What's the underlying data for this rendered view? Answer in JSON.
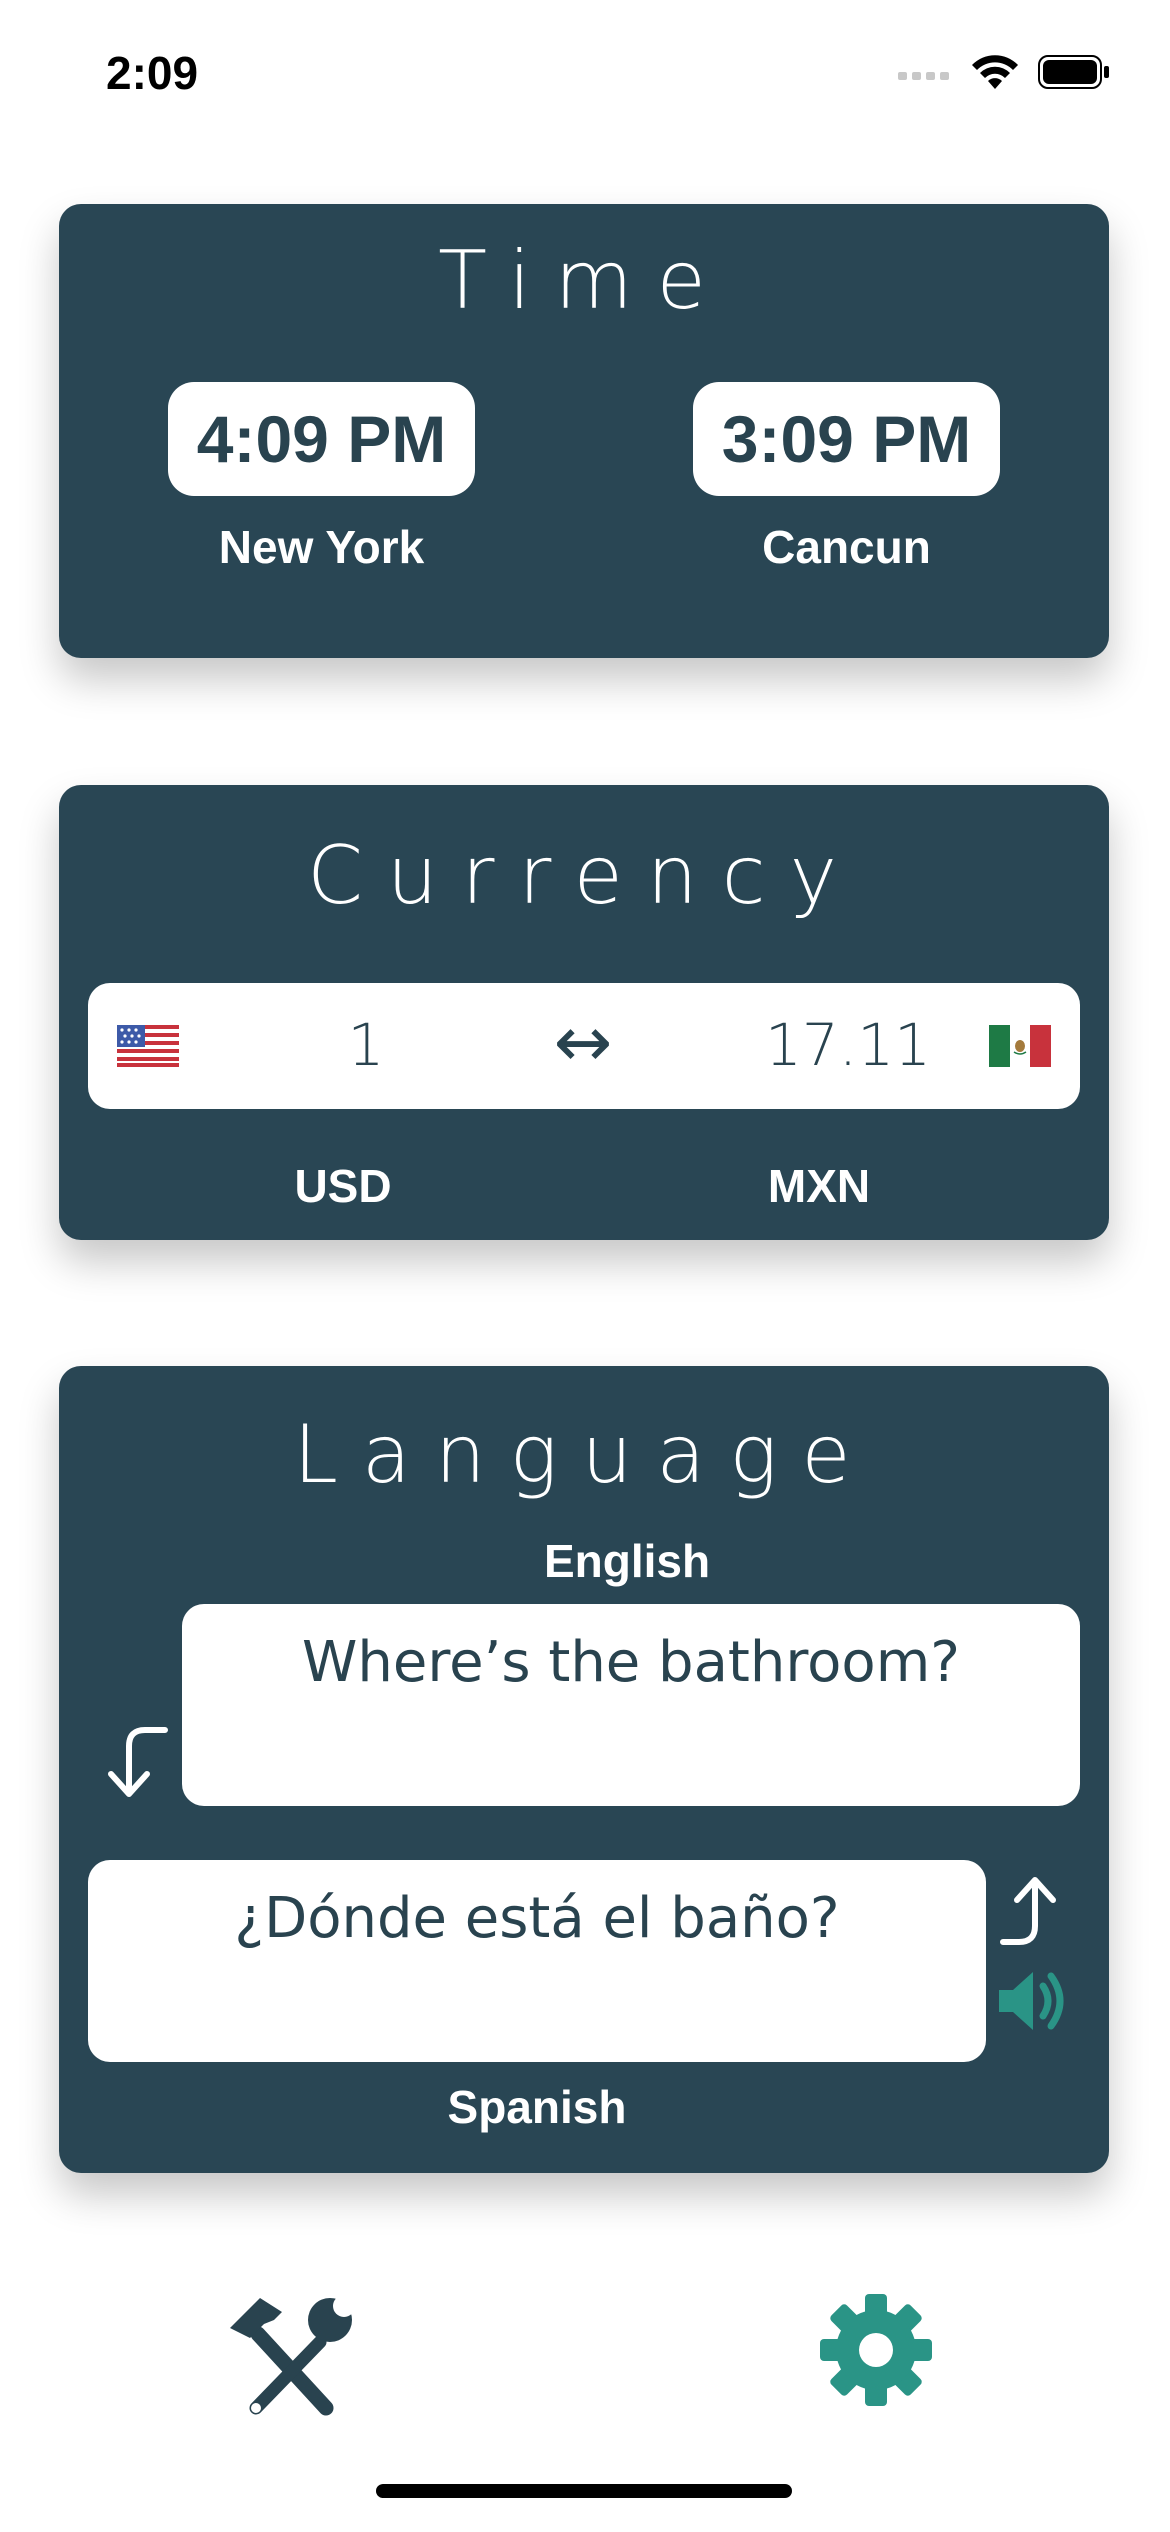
{
  "status": {
    "time": "2:09"
  },
  "time_card": {
    "title": "Time",
    "left": {
      "time": "4:09 PM",
      "city": "New York"
    },
    "right": {
      "time": "3:09 PM",
      "city": "Cancun"
    }
  },
  "currency_card": {
    "title": "Currency",
    "from_value": "1",
    "to_value": "17.11",
    "swap_icon": "↔",
    "from_code": "USD",
    "to_code": "MXN"
  },
  "language_card": {
    "title": "Language",
    "source_lang": "English",
    "source_text": "Where’s the bathroom?",
    "target_text": "¿Dónde está el baño?",
    "target_lang": "Spanish"
  },
  "colors": {
    "card_bg": "#294654",
    "accent_teal": "#2a9486",
    "text_dark": "#29434f"
  },
  "tab_bar": {
    "left_icon": "tools-icon",
    "right_icon": "gear-icon"
  }
}
